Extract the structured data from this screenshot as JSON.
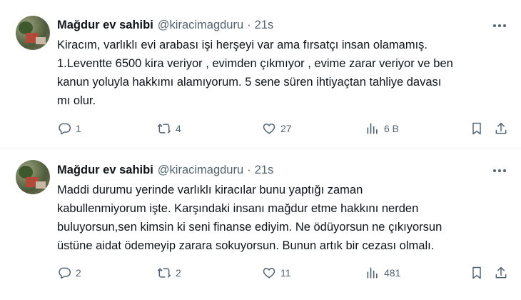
{
  "tweets": [
    {
      "name": "Mağdur ev sahibi",
      "handle": "@kiracimagduru",
      "dot": "·",
      "time": "21s",
      "lines": [
        "Kiracım, varlıklı evi arabası işi herşeyi var ama fırsatçı insan olamamış.",
        "1.Leventte 6500 kira veriyor , evimden çıkmıyor , evime zarar veriyor ve ben",
        "kanun yoluyla hakkımı alamıyorum. 5 sene süren ihtiyaçtan tahliye davası",
        "mı olur."
      ],
      "replies": "1",
      "retweets": "4",
      "likes": "27",
      "views": "6 B"
    },
    {
      "name": "Mağdur ev sahibi",
      "handle": "@kiracimagduru",
      "dot": "·",
      "time": "21s",
      "lines": [
        "Maddi durumu yerinde varlıklı kiracılar bunu yaptığı zaman",
        "kabullenmiyorum işte. Karşındaki insanı mağdur etme hakkını nerden",
        "buluyorsun,sen kimsin ki seni finanse ediyim. Ne ödüyorsun ne çıkıyorsun",
        "üstüne aidat ödemeyip zarara sokuyorsun. Bunun artık bir cezası olmalı."
      ],
      "replies": "2",
      "retweets": "2",
      "likes": "11",
      "views": "481"
    }
  ],
  "icons": {
    "reply": "reply-icon",
    "retweet": "retweet-icon",
    "like": "heart-icon",
    "views": "views-icon",
    "bookmark": "bookmark-icon",
    "share": "share-icon",
    "more": "more-icon"
  },
  "colors": {
    "text": "#0f1419",
    "secondary": "#536471",
    "divider": "#eff3f4"
  }
}
